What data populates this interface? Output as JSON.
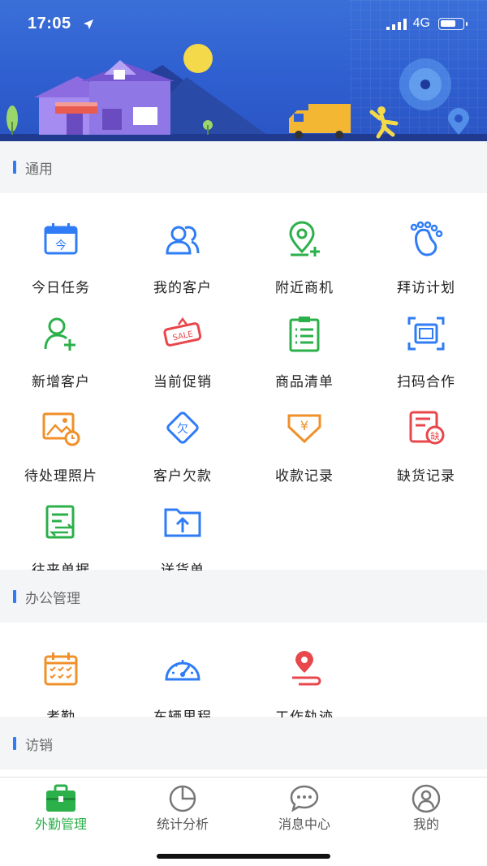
{
  "status_bar": {
    "time": "17:05",
    "network": "4G"
  },
  "sections": [
    {
      "title": "通用",
      "items": [
        "今日任务",
        "我的客户",
        "附近商机",
        "拜访计划",
        "新增客户",
        "当前促销",
        "商品清单",
        "扫码合作",
        "待处理照片",
        "客户欠款",
        "收款记录",
        "缺货记录",
        "往来单据",
        "送货单"
      ]
    },
    {
      "title": "办公管理",
      "items": [
        "考勤",
        "车辆里程",
        "工作轨迹"
      ]
    },
    {
      "title": "访销",
      "items": []
    }
  ],
  "icons": {
    "general": [
      "calendar-today-icon",
      "customers-icon",
      "location-add-icon",
      "footprints-icon",
      "add-user-icon",
      "sale-tag-icon",
      "clipboard-list-icon",
      "scan-frame-icon",
      "photo-pending-icon",
      "debt-icon",
      "payment-record-icon",
      "out-of-stock-icon",
      "document-exchange-icon",
      "upload-folder-icon"
    ],
    "office": [
      "attendance-calendar-icon",
      "speedometer-icon",
      "route-pin-icon"
    ]
  },
  "sale_tag_text": "SALE",
  "debt_glyph": "欠",
  "yen_glyph": "¥",
  "shortage_glyph": "缺",
  "today_glyph": "今",
  "tabbar": [
    {
      "label": "外勤管理",
      "icon": "briefcase-icon",
      "active": true
    },
    {
      "label": "统计分析",
      "icon": "pie-chart-icon",
      "active": false
    },
    {
      "label": "消息中心",
      "icon": "chat-bubble-icon",
      "active": false
    },
    {
      "label": "我的",
      "icon": "profile-icon",
      "active": false
    }
  ],
  "colors": {
    "accent_blue": "#2f7cf6",
    "green": "#2bb04a",
    "orange": "#f0902a",
    "red": "#e8474c",
    "banner": "#2f5fd0"
  }
}
